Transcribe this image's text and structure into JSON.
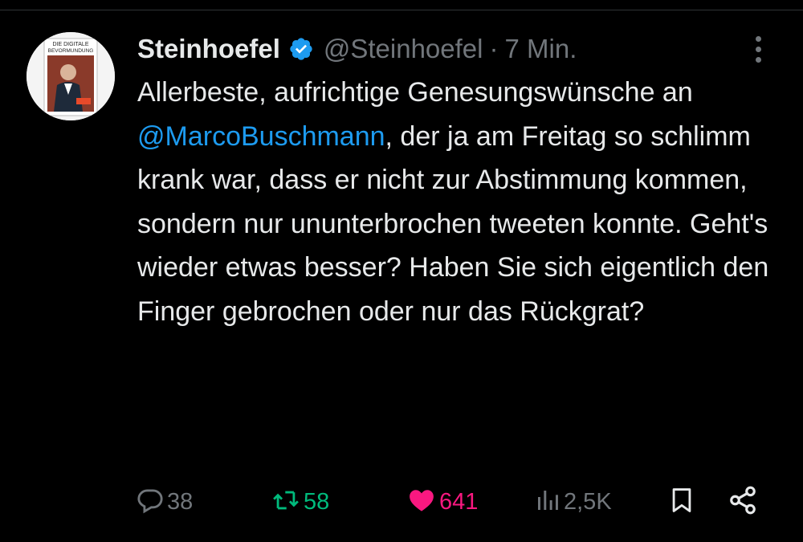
{
  "tweet": {
    "author_name": "Steinhoefel",
    "handle": "@Steinhoefel",
    "separator": "·",
    "time": "7 Min.",
    "avatar_text_1": "DIE DIGITALE",
    "avatar_text_2": "BEVORMUNDUNG",
    "text_before": "Allerbeste, aufrichtige Genesungswünsche an ",
    "mention": "@MarcoBuschmann",
    "text_after": ", der ja am Freitag so schlimm krank war, dass er nicht zur Abstimmung kommen, sondern nur ununterbrochen tweeten konnte. Geht's wieder etwas besser? Haben Sie sich eigentlich den Finger gebrochen oder nur das Rückgrat?"
  },
  "actions": {
    "replies": "38",
    "retweets": "58",
    "likes": "641",
    "views": "2,5K"
  },
  "icons": {
    "verified": "verified-badge-icon",
    "more": "more-vertical-icon",
    "reply": "reply-icon",
    "retweet": "retweet-icon",
    "like": "heart-icon",
    "views": "views-icon",
    "bookmark": "bookmark-icon",
    "share": "share-icon"
  },
  "colors": {
    "background": "#000000",
    "text": "#e7e9ea",
    "muted": "#71767b",
    "link": "#1d9bf0",
    "retweet": "#00ba7c",
    "like": "#f91880"
  }
}
